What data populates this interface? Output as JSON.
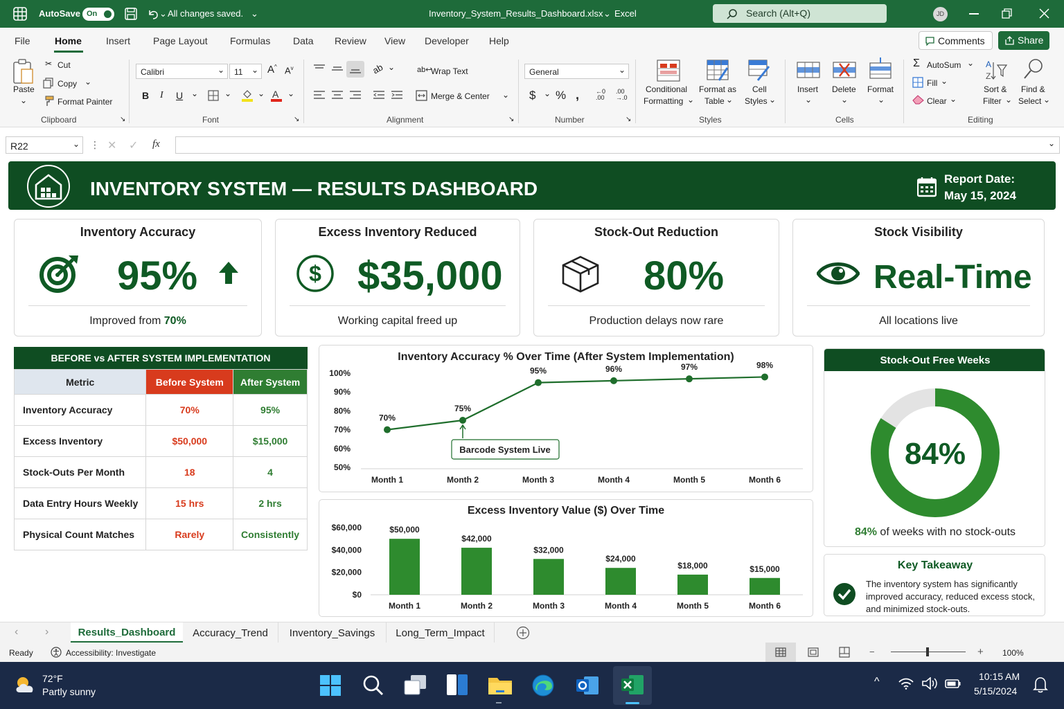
{
  "titlebar": {
    "autosave_label": "AutoSave",
    "autosave_state": "On",
    "save_status": "All changes saved.",
    "filename": "Inventory_System_Results_Dashboard.xlsx",
    "app_name": "Excel",
    "search_placeholder": "Search (Alt+Q)",
    "user_initials": "JD"
  },
  "ribbon_tabs": [
    "File",
    "Home",
    "Insert",
    "Page Layout",
    "Formulas",
    "Data",
    "Review",
    "View",
    "Developer",
    "Help"
  ],
  "ribbon_actions": {
    "comments": "Comments",
    "share": "Share"
  },
  "ribbon": {
    "clipboard": {
      "paste": "Paste",
      "cut": "Cut",
      "copy": "Copy",
      "format_painter": "Format Painter",
      "group": "Clipboard"
    },
    "font": {
      "name": "Calibri",
      "size": "11",
      "group": "Font"
    },
    "alignment": {
      "wrap": "Wrap Text",
      "merge": "Merge & Center",
      "group": "Alignment"
    },
    "number": {
      "format": "General",
      "group": "Number"
    },
    "styles": {
      "cond1": "Conditional",
      "cond2": "Formatting",
      "fmt1": "Format as",
      "fmt2": "Table",
      "cell1": "Cell",
      "cell2": "Styles",
      "group": "Styles"
    },
    "cells": {
      "insert": "Insert",
      "delete": "Delete",
      "format": "Format",
      "group": "Cells"
    },
    "editing": {
      "autosum": "AutoSum",
      "fill": "Fill",
      "clear": "Clear",
      "sort1": "Sort &",
      "sort2": "Filter",
      "find1": "Find &",
      "find2": "Select",
      "group": "Editing"
    }
  },
  "formula_bar": {
    "cell_ref": "R22",
    "fx": "fx",
    "value": ""
  },
  "dashboard": {
    "title": "INVENTORY SYSTEM — RESULTS DASHBOARD",
    "report_date_label": "Report Date:",
    "report_date": "May 15, 2024",
    "kpis": [
      {
        "title": "Inventory Accuracy",
        "value": "95%",
        "sub_prefix": "Improved from ",
        "sub_highlight": "70%"
      },
      {
        "title": "Excess Inventory Reduced",
        "value": "$35,000",
        "sub": "Working capital freed up"
      },
      {
        "title": "Stock-Out Reduction",
        "value": "80%",
        "sub": "Production delays now rare"
      },
      {
        "title": "Stock Visibility",
        "value": "Real-Time",
        "sub": "All locations live"
      }
    ],
    "comparison": {
      "title": "BEFORE vs AFTER SYSTEM IMPLEMENTATION",
      "headers": [
        "Metric",
        "Before System",
        "After System"
      ],
      "rows": [
        [
          "Inventory Accuracy",
          "70%",
          "95%"
        ],
        [
          "Excess Inventory",
          "$50,000",
          "$15,000"
        ],
        [
          "Stock-Outs Per Month",
          "18",
          "4"
        ],
        [
          "Data Entry Hours Weekly",
          "15 hrs",
          "2 hrs"
        ],
        [
          "Physical Count Matches",
          "Rarely",
          "Consistently"
        ]
      ]
    },
    "donut": {
      "title": "Stock-Out Free Weeks",
      "value": 84,
      "label": "84%",
      "caption_highlight": "84%",
      "caption": " of weeks with no stock-outs"
    },
    "takeaway": {
      "title": "Key Takeaway",
      "text": "The inventory system has significantly improved accuracy, reduced excess stock, and minimized stock-outs."
    }
  },
  "colors": {
    "brand": "#0f4d22",
    "accent": "#2e8b2e",
    "before": "#d83b1d",
    "after": "#2f7d32"
  },
  "chart_data": [
    {
      "type": "line",
      "title": "Inventory Accuracy % Over Time (After System Implementation)",
      "categories": [
        "Month 1",
        "Month 2",
        "Month 3",
        "Month 4",
        "Month 5",
        "Month 6"
      ],
      "values": [
        70,
        75,
        95,
        96,
        97,
        98
      ],
      "data_labels": [
        "70%",
        "75%",
        "95%",
        "96%",
        "97%",
        "98%"
      ],
      "y_ticks": [
        "50%",
        "60%",
        "70%",
        "80%",
        "90%",
        "100%"
      ],
      "ylim": [
        50,
        100
      ],
      "annotation": "Barcode System Live",
      "annotation_category": "Month 2",
      "grid": false
    },
    {
      "type": "bar",
      "title": "Excess Inventory Value ($) Over Time",
      "categories": [
        "Month 1",
        "Month 2",
        "Month 3",
        "Month 4",
        "Month 5",
        "Month 6"
      ],
      "values": [
        50000,
        42000,
        32000,
        24000,
        18000,
        15000
      ],
      "data_labels": [
        "$50,000",
        "$42,000",
        "$32,000",
        "$24,000",
        "$18,000",
        "$15,000"
      ],
      "y_ticks": [
        "$0",
        "$20,000",
        "$40,000",
        "$60,000"
      ],
      "ylim": [
        0,
        60000
      ],
      "grid": false
    }
  ],
  "sheet_tabs": [
    "Results_Dashboard",
    "Accuracy_Trend",
    "Inventory_Savings",
    "Long_Term_Impact"
  ],
  "statusbar": {
    "ready": "Ready",
    "accessibility": "Accessibility: Investigate",
    "zoom": "100%"
  },
  "taskbar": {
    "temp": "72°F",
    "weather": "Partly sunny",
    "time": "10:15 AM",
    "date": "5/15/2024"
  }
}
